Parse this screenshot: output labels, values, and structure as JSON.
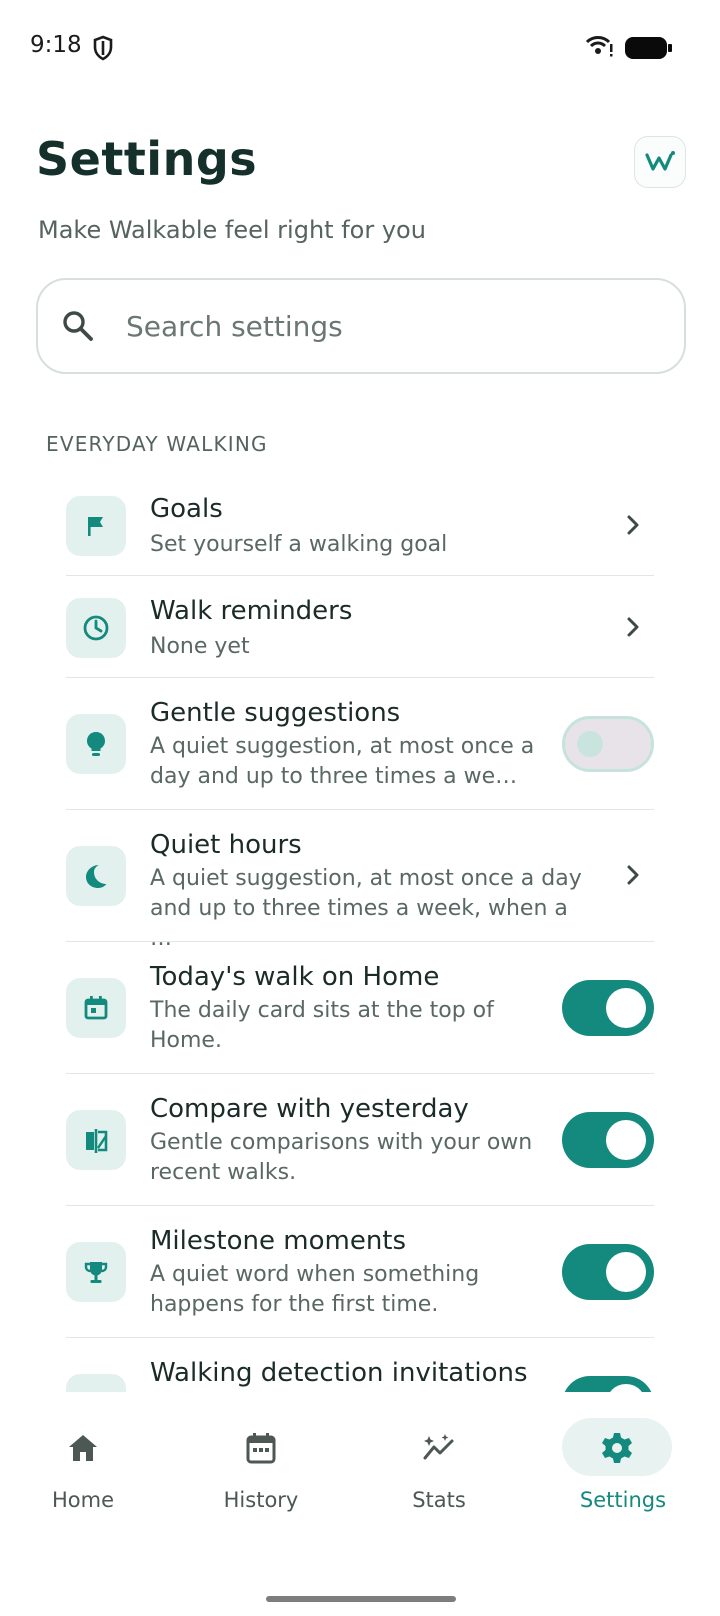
{
  "status_bar": {
    "time": "9:18",
    "icons": [
      "shield-icon",
      "wifi-icon",
      "battery-icon"
    ]
  },
  "header": {
    "title": "Settings",
    "subtitle": "Make Walkable feel right for you",
    "logo_text": "W"
  },
  "search": {
    "placeholder": "Search settings",
    "value": ""
  },
  "section": {
    "title": "EVERYDAY WALKING",
    "items": [
      {
        "title": "Goals",
        "description": "Set yourself a walking goal",
        "icon": "flag-icon",
        "control": "chevron"
      },
      {
        "title": "Walk reminders",
        "description": "None yet",
        "icon": "clock-icon",
        "control": "chevron"
      },
      {
        "title": "Gentle suggestions",
        "description": "A quiet suggestion, at most once a day and up to three times a we…",
        "icon": "lightbulb-icon",
        "control": "toggle",
        "enabled": false
      },
      {
        "title": "Quiet hours",
        "description": "A quiet suggestion, at most once a day and up to three times a week, when a …",
        "icon": "moon-icon",
        "control": "chevron"
      },
      {
        "title": "Today's walk on Home",
        "description": "The daily card sits at the top of Home.",
        "icon": "calendar-icon",
        "control": "toggle",
        "enabled": true
      },
      {
        "title": "Compare with yesterday",
        "description": "Gentle comparisons with your own recent walks.",
        "icon": "compare-icon",
        "control": "toggle",
        "enabled": true
      },
      {
        "title": "Milestone moments",
        "description": "A quiet word when something happens for the first time.",
        "icon": "trophy-icon",
        "control": "toggle",
        "enabled": true
      },
      {
        "title": "Walking detection invitations",
        "description": "",
        "icon": "info-icon",
        "control": "toggle",
        "enabled": true
      }
    ]
  },
  "bottom_nav": {
    "items": [
      {
        "label": "Home",
        "icon": "home-icon",
        "active": false
      },
      {
        "label": "History",
        "icon": "calendar-icon",
        "active": false
      },
      {
        "label": "Stats",
        "icon": "stats-icon",
        "active": false
      },
      {
        "label": "Settings",
        "icon": "gear-icon",
        "active": true
      }
    ]
  },
  "colors": {
    "accent": "#138a7d",
    "icon_bg": "#e3f1ee",
    "text_primary": "#1b2b28",
    "text_secondary": "#5a6864"
  }
}
